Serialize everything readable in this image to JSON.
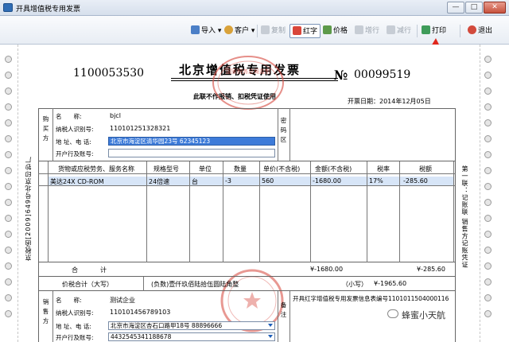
{
  "window": {
    "title": "开具增值税专用发票",
    "controls": [
      "—",
      "□",
      "✕"
    ]
  },
  "toolbar": {
    "import_label": "导入",
    "customer_label": "客户",
    "copy_label": "复制",
    "red_label": "红字",
    "price_label": "价格",
    "add_row_label": "增行",
    "delete_row_label": "减行",
    "print_label": "打印",
    "exit_label": "退出"
  },
  "invoice": {
    "code": "1100053530",
    "title": "北京增值税专用发票",
    "subtitle": "此联不作报销、扣税凭证使用",
    "number_symbol": "№",
    "number": "00099519",
    "date_label": "开票日期：",
    "date": "2014年12月05日",
    "stamp_text": "国家税务总局监制",
    "left_side": "京税函[2009]649号北京印钞厂",
    "right_side": "第一联：记账联 销售方记账凭证"
  },
  "buyer": {
    "side_label": "购买方",
    "name_label": "名　　称:",
    "name": "bjcl",
    "tax_id_label": "纳税人识别号:",
    "tax_id": "110101251328321",
    "address_label": "地 址、电 话:",
    "address": "北京市海淀区清华园23号 62345123",
    "bank_label": "开户行及账号:",
    "bank": "",
    "cipher_label": "密码区"
  },
  "items": {
    "headers": [
      "货物或应税劳务、服务名称",
      "规格型号",
      "单位",
      "数量",
      "单价(不含税)",
      "金额(不含税)",
      "税率",
      "税额"
    ],
    "rows": [
      [
        "美达24X CD-ROM",
        "24倍速",
        "台",
        "-3",
        "560",
        "-1680.00",
        "17%",
        "-285.60"
      ]
    ]
  },
  "totals": {
    "total_label": "合　　　计",
    "amount": "¥-1680.00",
    "tax": "¥-285.60",
    "grand_label": "价税合计（大写）",
    "grand_words": "(负数)壹仟玖佰陆拾伍圆陆角整",
    "small_label": "（小写）",
    "grand_small": "¥-1965.60"
  },
  "seller": {
    "side_label": "销售方",
    "name_label": "名　　称:",
    "name": "测试企业",
    "tax_id_label": "纳税人识别号:",
    "tax_id": "110101456789103",
    "address_label": "地 址、电 话:",
    "address": "北京市海淀区杏石口路甲18号 88896666",
    "bank_label": "开户行及账号:",
    "bank": "4432545341188678",
    "remarks_label": "备注",
    "remarks": "开具红字增值税专用发票信息表编号1101011504000116"
  },
  "watermark": "蜂蜜小天航"
}
